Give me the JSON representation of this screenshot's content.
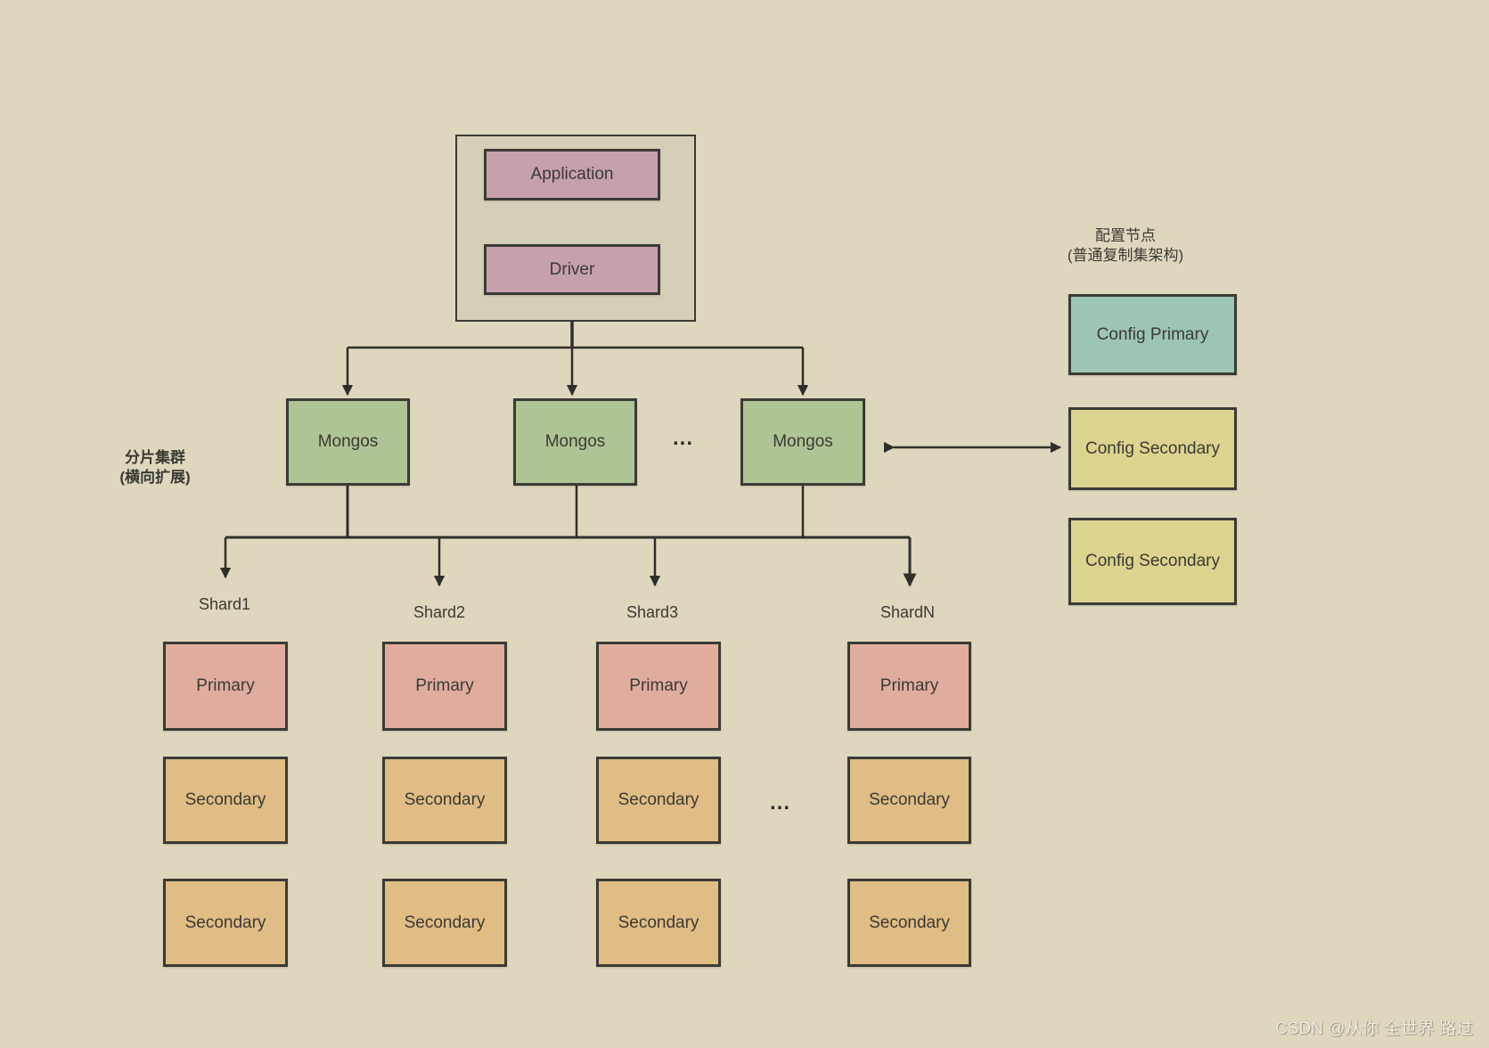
{
  "client": {
    "application_label": "Application",
    "driver_label": "Driver"
  },
  "mongos": [
    {
      "label": "Mongos"
    },
    {
      "label": "Mongos"
    },
    {
      "label": "Mongos"
    }
  ],
  "mongos_ellipsis": "...",
  "shard_cluster_caption": {
    "line1": "分片集群",
    "line2": "(横向扩展)"
  },
  "config": {
    "caption_line1": "配置节点",
    "caption_line2": "(普通复制集架构)",
    "nodes": [
      {
        "label": "Config Primary",
        "role": "primary"
      },
      {
        "label": "Config Secondary",
        "role": "secondary"
      },
      {
        "label": "Config Secondary",
        "role": "secondary"
      }
    ]
  },
  "shards": [
    {
      "name": "Shard1",
      "nodes": [
        "Primary",
        "Secondary",
        "Secondary"
      ]
    },
    {
      "name": "Shard2",
      "nodes": [
        "Primary",
        "Secondary",
        "Secondary"
      ]
    },
    {
      "name": "Shard3",
      "nodes": [
        "Primary",
        "Secondary",
        "Secondary"
      ]
    },
    {
      "name": "ShardN",
      "nodes": [
        "Primary",
        "Secondary",
        "Secondary"
      ]
    }
  ],
  "shards_ellipsis": "...",
  "colors": {
    "background": "#dfd7bd",
    "client_node": "#c7a0ae",
    "mongos_node": "#afc494",
    "config_primary": "#9cc6b1",
    "config_secondary": "#dcd38e",
    "shard_primary": "#e0ac9e",
    "shard_secondary": "#e0bd84",
    "stroke": "#3b3b35"
  },
  "watermark": "CSDN @从你 全世界 路过"
}
